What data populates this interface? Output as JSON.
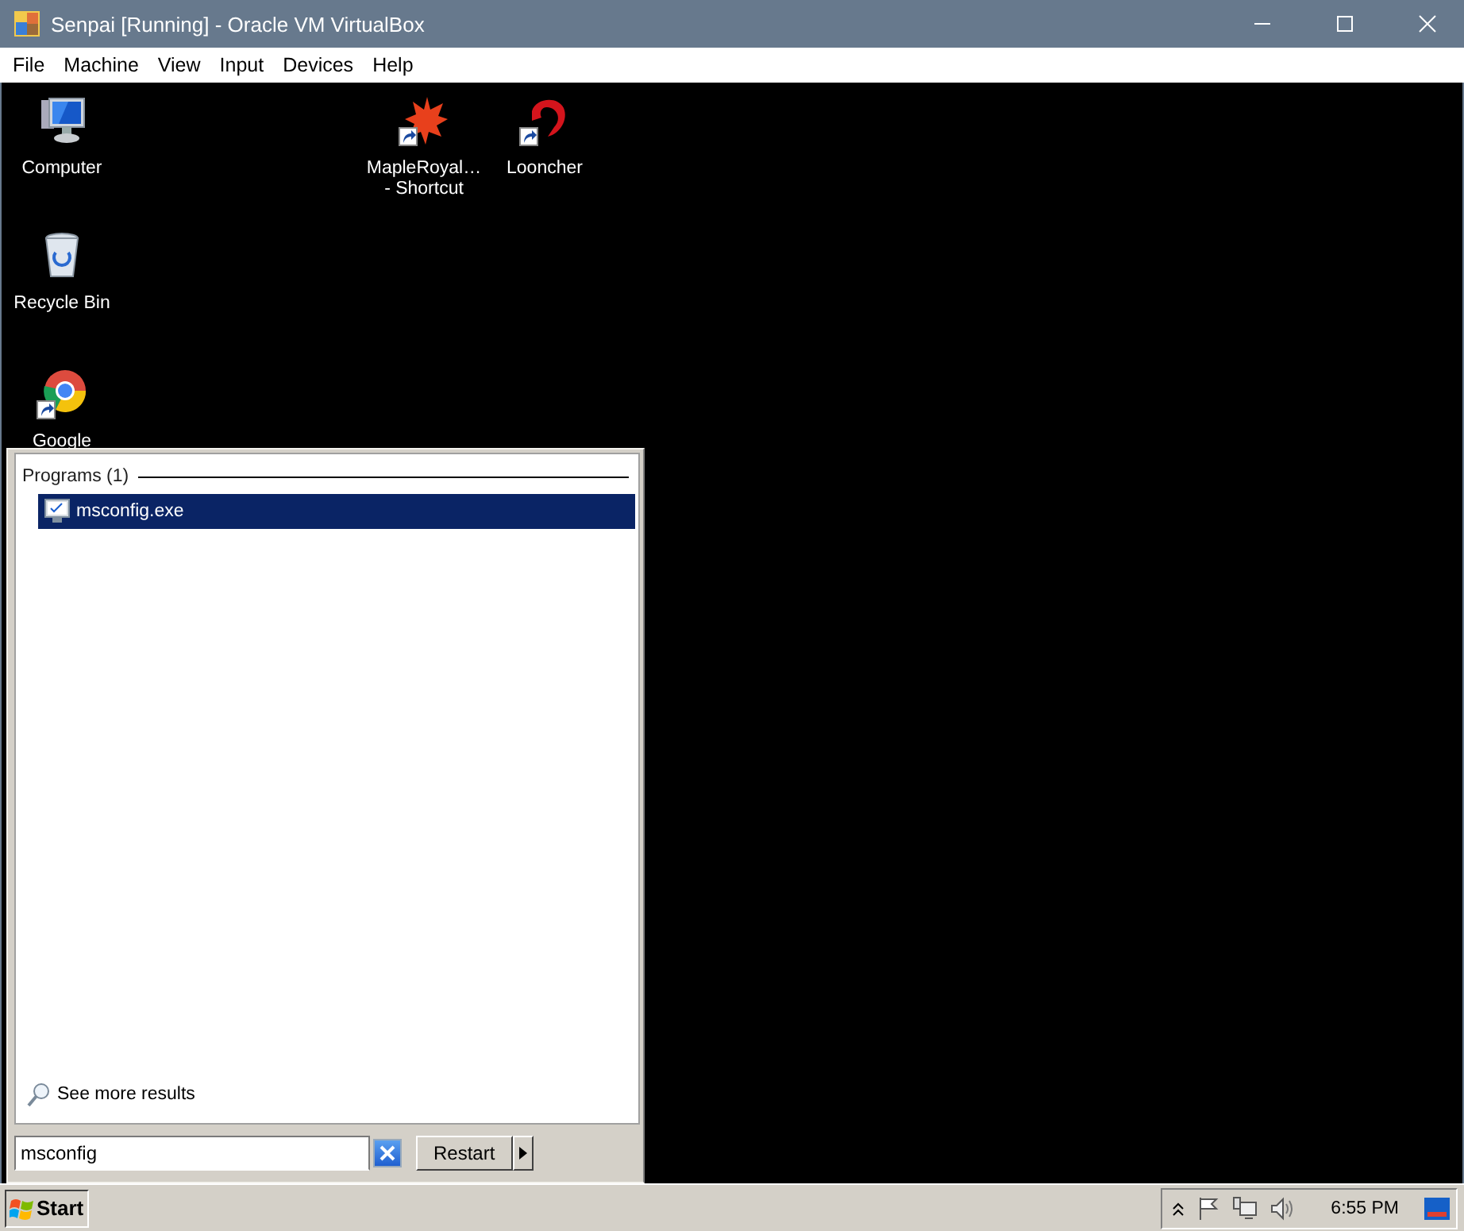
{
  "window": {
    "title": "Senpai [Running] - Oracle VM VirtualBox"
  },
  "menu": [
    "File",
    "Machine",
    "View",
    "Input",
    "Devices",
    "Help"
  ],
  "desktop_icons": [
    {
      "kind": "computer",
      "lines": [
        "Computer"
      ],
      "shortcut": false
    },
    {
      "kind": "recycle-bin",
      "lines": [
        "Recycle Bin"
      ],
      "shortcut": false
    },
    {
      "kind": "browser",
      "lines": [
        "Google"
      ],
      "shortcut": true
    },
    {
      "kind": "maple",
      "lines": [
        "MapleRoyal…",
        "- Shortcut"
      ],
      "shortcut": true
    },
    {
      "kind": "dragon",
      "lines": [
        "Looncher"
      ],
      "shortcut": true
    }
  ],
  "start_menu": {
    "section": "Programs (1)",
    "results": [
      {
        "label": "msconfig.exe",
        "selected": true
      }
    ],
    "more_results": "See more results",
    "search": {
      "value": "msconfig"
    },
    "power_button": "Restart"
  },
  "taskbar": {
    "start": "Start",
    "clock": "6:55 PM"
  }
}
